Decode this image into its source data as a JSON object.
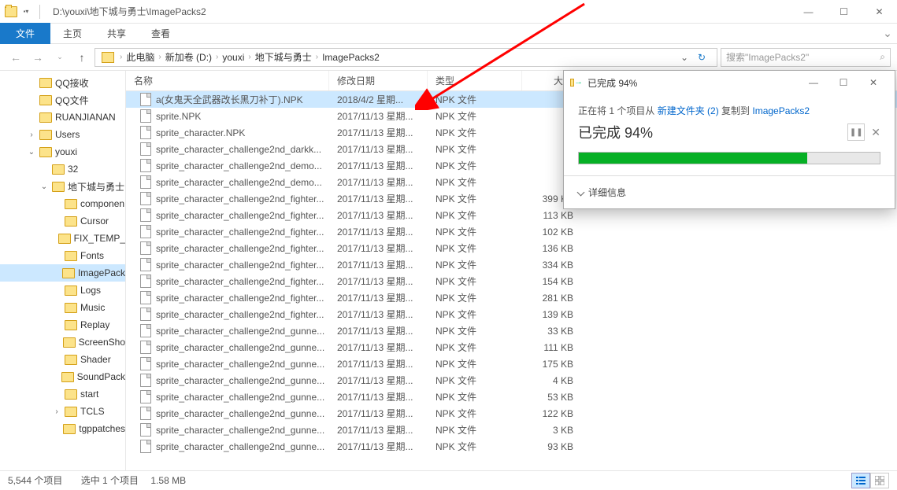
{
  "window": {
    "title_path": "D:\\youxi\\地下城与勇士\\ImagePacks2",
    "min": "—",
    "max": "☐",
    "close": "✕"
  },
  "ribbon": {
    "file": "文件",
    "home": "主页",
    "share": "共享",
    "view": "查看"
  },
  "breadcrumb": {
    "items": [
      "此电脑",
      "新加卷 (D:)",
      "youxi",
      "地下城与勇士",
      "ImagePacks2"
    ],
    "sep": "›"
  },
  "search": {
    "placeholder": "搜索\"ImagePacks2\""
  },
  "tree": [
    {
      "d": 0,
      "label": "QQ接收",
      "exp": ""
    },
    {
      "d": 0,
      "label": "QQ文件",
      "exp": ""
    },
    {
      "d": 0,
      "label": "RUANJIANAN",
      "exp": ""
    },
    {
      "d": 0,
      "label": "Users",
      "exp": "›"
    },
    {
      "d": 0,
      "label": "youxi",
      "exp": "⌄",
      "open": true
    },
    {
      "d": 1,
      "label": "32",
      "exp": ""
    },
    {
      "d": 1,
      "label": "地下城与勇士",
      "exp": "⌄",
      "open": true
    },
    {
      "d": 2,
      "label": "componen",
      "exp": ""
    },
    {
      "d": 2,
      "label": "Cursor",
      "exp": ""
    },
    {
      "d": 2,
      "label": "FIX_TEMP_",
      "exp": ""
    },
    {
      "d": 2,
      "label": "Fonts",
      "exp": ""
    },
    {
      "d": 2,
      "label": "ImagePack",
      "exp": "",
      "sel": true
    },
    {
      "d": 2,
      "label": "Logs",
      "exp": ""
    },
    {
      "d": 2,
      "label": "Music",
      "exp": ""
    },
    {
      "d": 2,
      "label": "Replay",
      "exp": ""
    },
    {
      "d": 2,
      "label": "ScreenSho",
      "exp": ""
    },
    {
      "d": 2,
      "label": "Shader",
      "exp": ""
    },
    {
      "d": 2,
      "label": "SoundPack",
      "exp": ""
    },
    {
      "d": 2,
      "label": "start",
      "exp": ""
    },
    {
      "d": 2,
      "label": "TCLS",
      "exp": "›"
    },
    {
      "d": 2,
      "label": "tgppatches",
      "exp": ""
    }
  ],
  "columns": {
    "name": "名称",
    "date": "修改日期",
    "type": "类型",
    "size": "大小"
  },
  "files": [
    {
      "name": "a(女鬼天全武器改长黑刀补丁).NPK",
      "date": "2018/4/2 星期...",
      "type": "NPK 文件",
      "size": "",
      "sel": true
    },
    {
      "name": "sprite.NPK",
      "date": "2017/11/13 星期...",
      "type": "NPK 文件",
      "size": ""
    },
    {
      "name": "sprite_character.NPK",
      "date": "2017/11/13 星期...",
      "type": "NPK 文件",
      "size": ""
    },
    {
      "name": "sprite_character_challenge2nd_darkk...",
      "date": "2017/11/13 星期...",
      "type": "NPK 文件",
      "size": ""
    },
    {
      "name": "sprite_character_challenge2nd_demo...",
      "date": "2017/11/13 星期...",
      "type": "NPK 文件",
      "size": ""
    },
    {
      "name": "sprite_character_challenge2nd_demo...",
      "date": "2017/11/13 星期...",
      "type": "NPK 文件",
      "size": ""
    },
    {
      "name": "sprite_character_challenge2nd_fighter...",
      "date": "2017/11/13 星期...",
      "type": "NPK 文件",
      "size": "399 KB"
    },
    {
      "name": "sprite_character_challenge2nd_fighter...",
      "date": "2017/11/13 星期...",
      "type": "NPK 文件",
      "size": "113 KB"
    },
    {
      "name": "sprite_character_challenge2nd_fighter...",
      "date": "2017/11/13 星期...",
      "type": "NPK 文件",
      "size": "102 KB"
    },
    {
      "name": "sprite_character_challenge2nd_fighter...",
      "date": "2017/11/13 星期...",
      "type": "NPK 文件",
      "size": "136 KB"
    },
    {
      "name": "sprite_character_challenge2nd_fighter...",
      "date": "2017/11/13 星期...",
      "type": "NPK 文件",
      "size": "334 KB"
    },
    {
      "name": "sprite_character_challenge2nd_fighter...",
      "date": "2017/11/13 星期...",
      "type": "NPK 文件",
      "size": "154 KB"
    },
    {
      "name": "sprite_character_challenge2nd_fighter...",
      "date": "2017/11/13 星期...",
      "type": "NPK 文件",
      "size": "281 KB"
    },
    {
      "name": "sprite_character_challenge2nd_fighter...",
      "date": "2017/11/13 星期...",
      "type": "NPK 文件",
      "size": "139 KB"
    },
    {
      "name": "sprite_character_challenge2nd_gunne...",
      "date": "2017/11/13 星期...",
      "type": "NPK 文件",
      "size": "33 KB"
    },
    {
      "name": "sprite_character_challenge2nd_gunne...",
      "date": "2017/11/13 星期...",
      "type": "NPK 文件",
      "size": "111 KB"
    },
    {
      "name": "sprite_character_challenge2nd_gunne...",
      "date": "2017/11/13 星期...",
      "type": "NPK 文件",
      "size": "175 KB"
    },
    {
      "name": "sprite_character_challenge2nd_gunne...",
      "date": "2017/11/13 星期...",
      "type": "NPK 文件",
      "size": "4 KB"
    },
    {
      "name": "sprite_character_challenge2nd_gunne...",
      "date": "2017/11/13 星期...",
      "type": "NPK 文件",
      "size": "53 KB"
    },
    {
      "name": "sprite_character_challenge2nd_gunne...",
      "date": "2017/11/13 星期...",
      "type": "NPK 文件",
      "size": "122 KB"
    },
    {
      "name": "sprite_character_challenge2nd_gunne...",
      "date": "2017/11/13 星期...",
      "type": "NPK 文件",
      "size": "3 KB"
    },
    {
      "name": "sprite_character_challenge2nd_gunne...",
      "date": "2017/11/13 星期...",
      "type": "NPK 文件",
      "size": "93 KB"
    }
  ],
  "status": {
    "count": "5,544 个项目",
    "selected": "选中 1 个项目",
    "size": "1.58 MB"
  },
  "dialog": {
    "title": "已完成 94%",
    "copying_pre": "正在将 1 个项目从 ",
    "copying_src": "新建文件夹 (2)",
    "copying_mid": " 复制到 ",
    "copying_dst": "ImagePacks2",
    "done": "已完成 94%",
    "details": "详细信息",
    "progress_pct": 76
  }
}
